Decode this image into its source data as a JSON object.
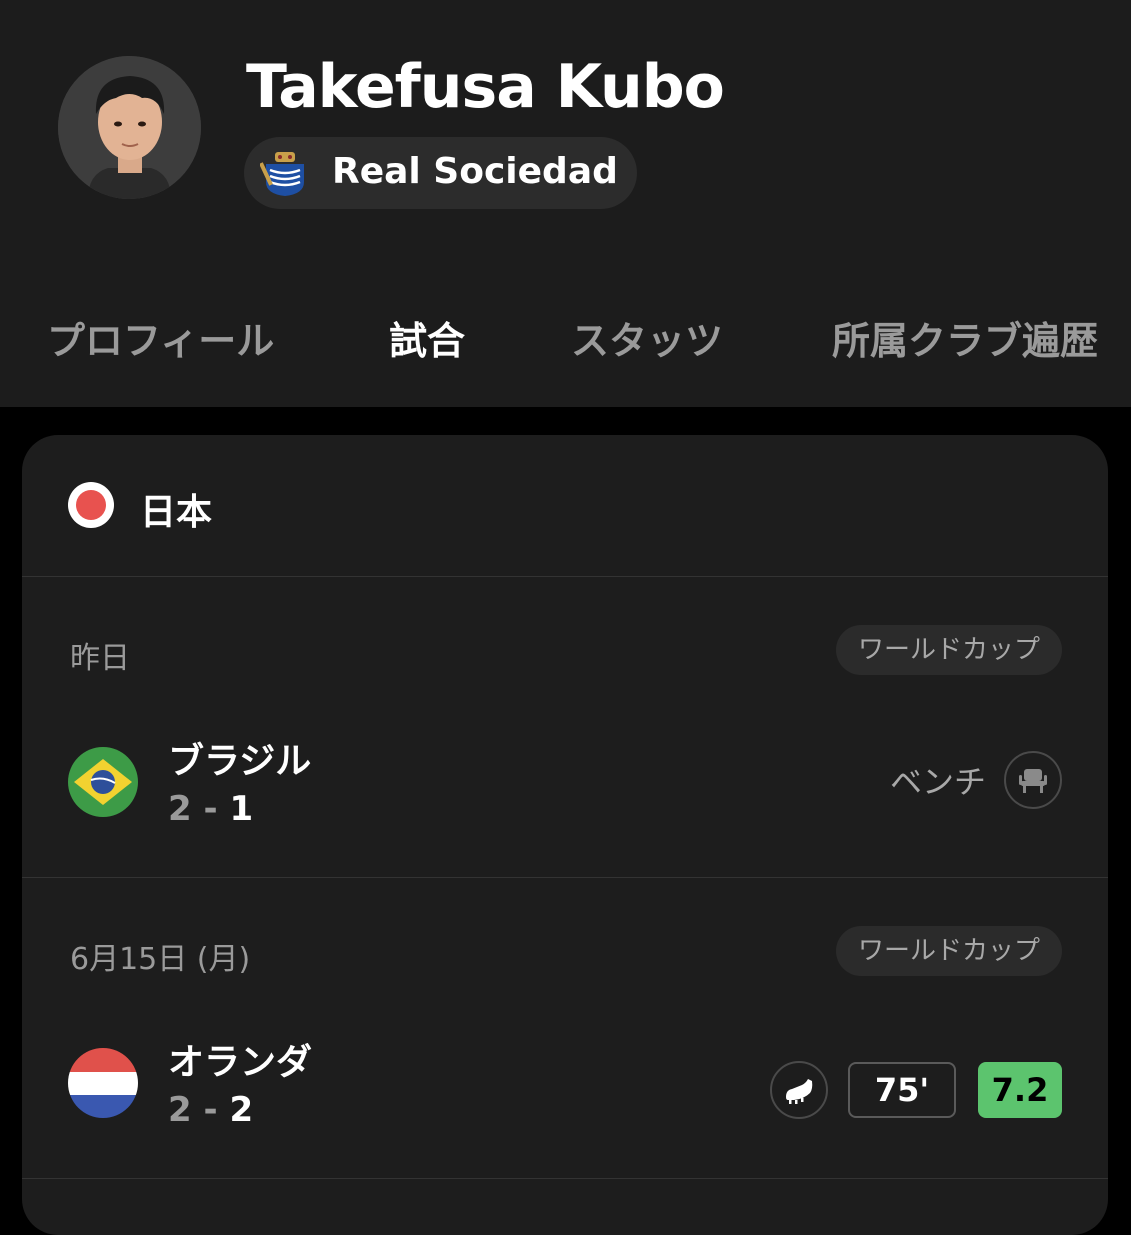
{
  "player": {
    "name": "Takefusa Kubo",
    "club": "Real Sociedad",
    "avatar": "player-photo"
  },
  "tabs": [
    {
      "label": "プロフィール",
      "active": false
    },
    {
      "label": "試合",
      "active": true
    },
    {
      "label": "スタッツ",
      "active": false
    },
    {
      "label": "所属クラブ遍歴",
      "active": false
    }
  ],
  "team": {
    "name": "日本",
    "flag_icon": "japan-flag-icon"
  },
  "matches": [
    {
      "date": "昨日",
      "competition": "ワールドカップ",
      "opponent": "ブラジル",
      "flag_icon": "brazil-flag-icon",
      "score_home": "2",
      "score_sep": "-",
      "score_away": "1",
      "status": "ベンチ",
      "status_icon": "bench-seat-icon"
    },
    {
      "date": "6月15日 (月)",
      "competition": "ワールドカップ",
      "opponent": "オランダ",
      "flag_icon": "netherlands-flag-icon",
      "score_home": "2",
      "score_sep": "-",
      "score_away": "2",
      "status_icon": "football-boot-icon",
      "minutes": "75'",
      "rating": "7.2"
    }
  ],
  "colors": {
    "background": "#000000",
    "header_bg": "#1c1c1c",
    "card_bg": "#1d1d1d",
    "rating_green": "#5cc46e",
    "japan_red": "#e8524f"
  }
}
